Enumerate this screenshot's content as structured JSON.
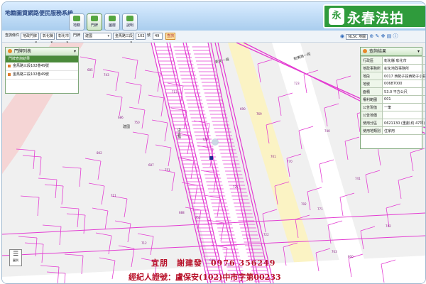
{
  "header": {
    "title": "地籍圖資網路便民服務系統",
    "tabs": [
      {
        "label": "地籍"
      },
      {
        "label": "門牌"
      },
      {
        "label": "圖層"
      },
      {
        "label": "說明"
      }
    ]
  },
  "brand": {
    "logo": "永",
    "text": "永春法拍"
  },
  "search": {
    "label1": "查詢條件",
    "mode": "地政門牌",
    "county": "彰化縣",
    "town": "彰化市",
    "label2": "門牌",
    "road": "建國",
    "section": "金馬路三段",
    "number": "102",
    "unit": "號",
    "floor": "49",
    "query_button": "查詢"
  },
  "tools": {
    "basemap": "NLSC 地圖"
  },
  "door_panel": {
    "title": "門牌列表",
    "header": "門牌查詢結果",
    "items": [
      "金馬路三段102巷49號",
      "金馬路三段102巷49號"
    ]
  },
  "result_panel": {
    "title": "查詢結果",
    "rows": [
      {
        "k": "行政區",
        "v": "彰化縣 彰化市"
      },
      {
        "k": "地政事務所",
        "v": "彰化地政事務所"
      },
      {
        "k": "地段",
        "v": "0017 西勢子段西勢子小段"
      },
      {
        "k": "地號",
        "v": "00687000"
      },
      {
        "k": "面積",
        "v": "53.0 平方公尺"
      },
      {
        "k": "權利範圍",
        "v": "001"
      },
      {
        "k": "公告現值",
        "v": "一筆"
      },
      {
        "k": "公告地價",
        "v": ""
      },
      {
        "k": "使用分區",
        "v": "0621130 (重劃 約 47坪)"
      },
      {
        "k": "使用地類別",
        "v": "住家用"
      }
    ]
  },
  "map": {
    "road_labels": [
      "彰化一段",
      "和美路一段",
      "中正路",
      "建國"
    ],
    "parcel_numbers": [
      "685",
      "686",
      "687",
      "688",
      "689",
      "690",
      "701",
      "702",
      "703",
      "704",
      "710",
      "711",
      "712",
      "713",
      "720",
      "721",
      "722",
      "723",
      "740",
      "741",
      "742",
      "743",
      "750",
      "751",
      "752",
      "768",
      "769",
      "770",
      "771",
      "800",
      "801",
      "802"
    ],
    "legend_label": "圖例"
  },
  "caption": {
    "line1": "宜朋　謝建發　0976 356249",
    "line2": "經紀人證號：盧保安(102)中市字第00233"
  },
  "colors": {
    "parcel": "#e33cd2",
    "brand": "#2f9b3c",
    "caption": "#b8122a"
  }
}
